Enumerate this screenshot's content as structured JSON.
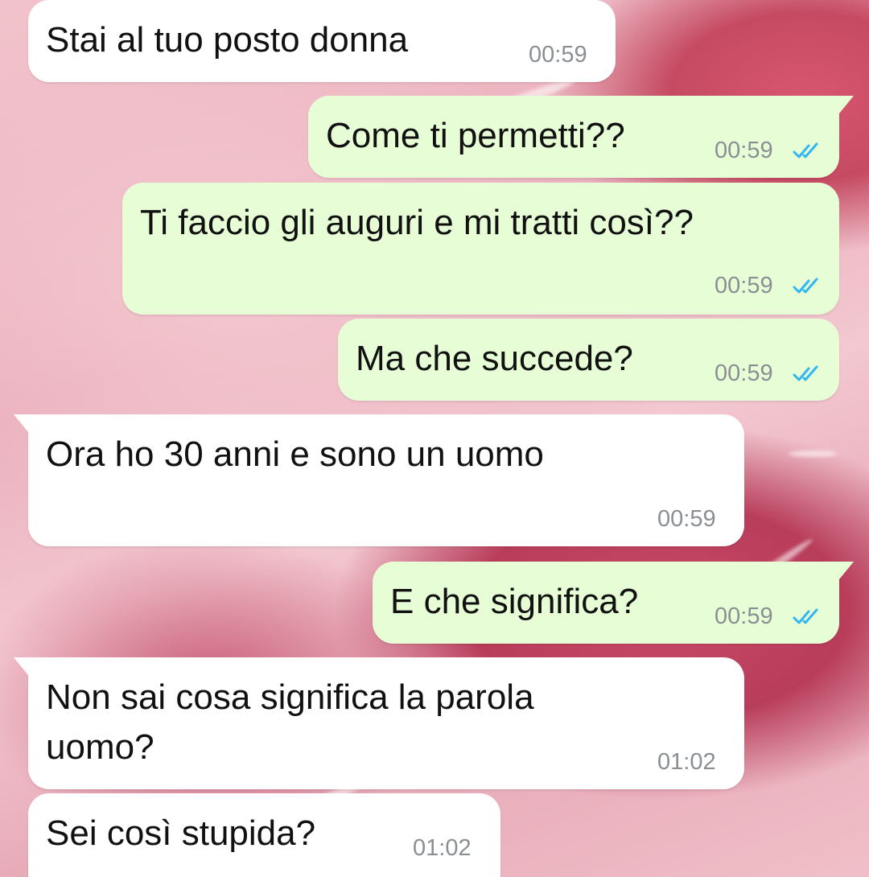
{
  "theme": {
    "incoming_bg": "#ffffff",
    "outgoing_bg": "#e7fdd6",
    "read_tick_color": "#34b7f1",
    "time_color": "#8a8f94"
  },
  "messages": [
    {
      "direction": "incoming",
      "text": "Stai al tuo posto donna",
      "time": "00:59"
    },
    {
      "direction": "outgoing",
      "text": "Come ti permetti??",
      "time": "00:59",
      "status": "read"
    },
    {
      "direction": "outgoing",
      "text": "Ti faccio gli auguri e mi tratti così??",
      "time": "00:59",
      "status": "read"
    },
    {
      "direction": "outgoing",
      "text": "Ma che succede?",
      "time": "00:59",
      "status": "read"
    },
    {
      "direction": "incoming",
      "text": "Ora ho 30 anni e sono un uomo",
      "time": "00:59"
    },
    {
      "direction": "outgoing",
      "text": "E che significa?",
      "time": "00:59",
      "status": "read"
    },
    {
      "direction": "incoming",
      "text_line1": "Non sai cosa significa la parola",
      "text_line2": "uomo?",
      "time": "01:02"
    },
    {
      "direction": "incoming",
      "text": "Sei così stupida?",
      "time": "01:02"
    }
  ],
  "icons": {
    "read_receipt": "double-check-icon"
  }
}
